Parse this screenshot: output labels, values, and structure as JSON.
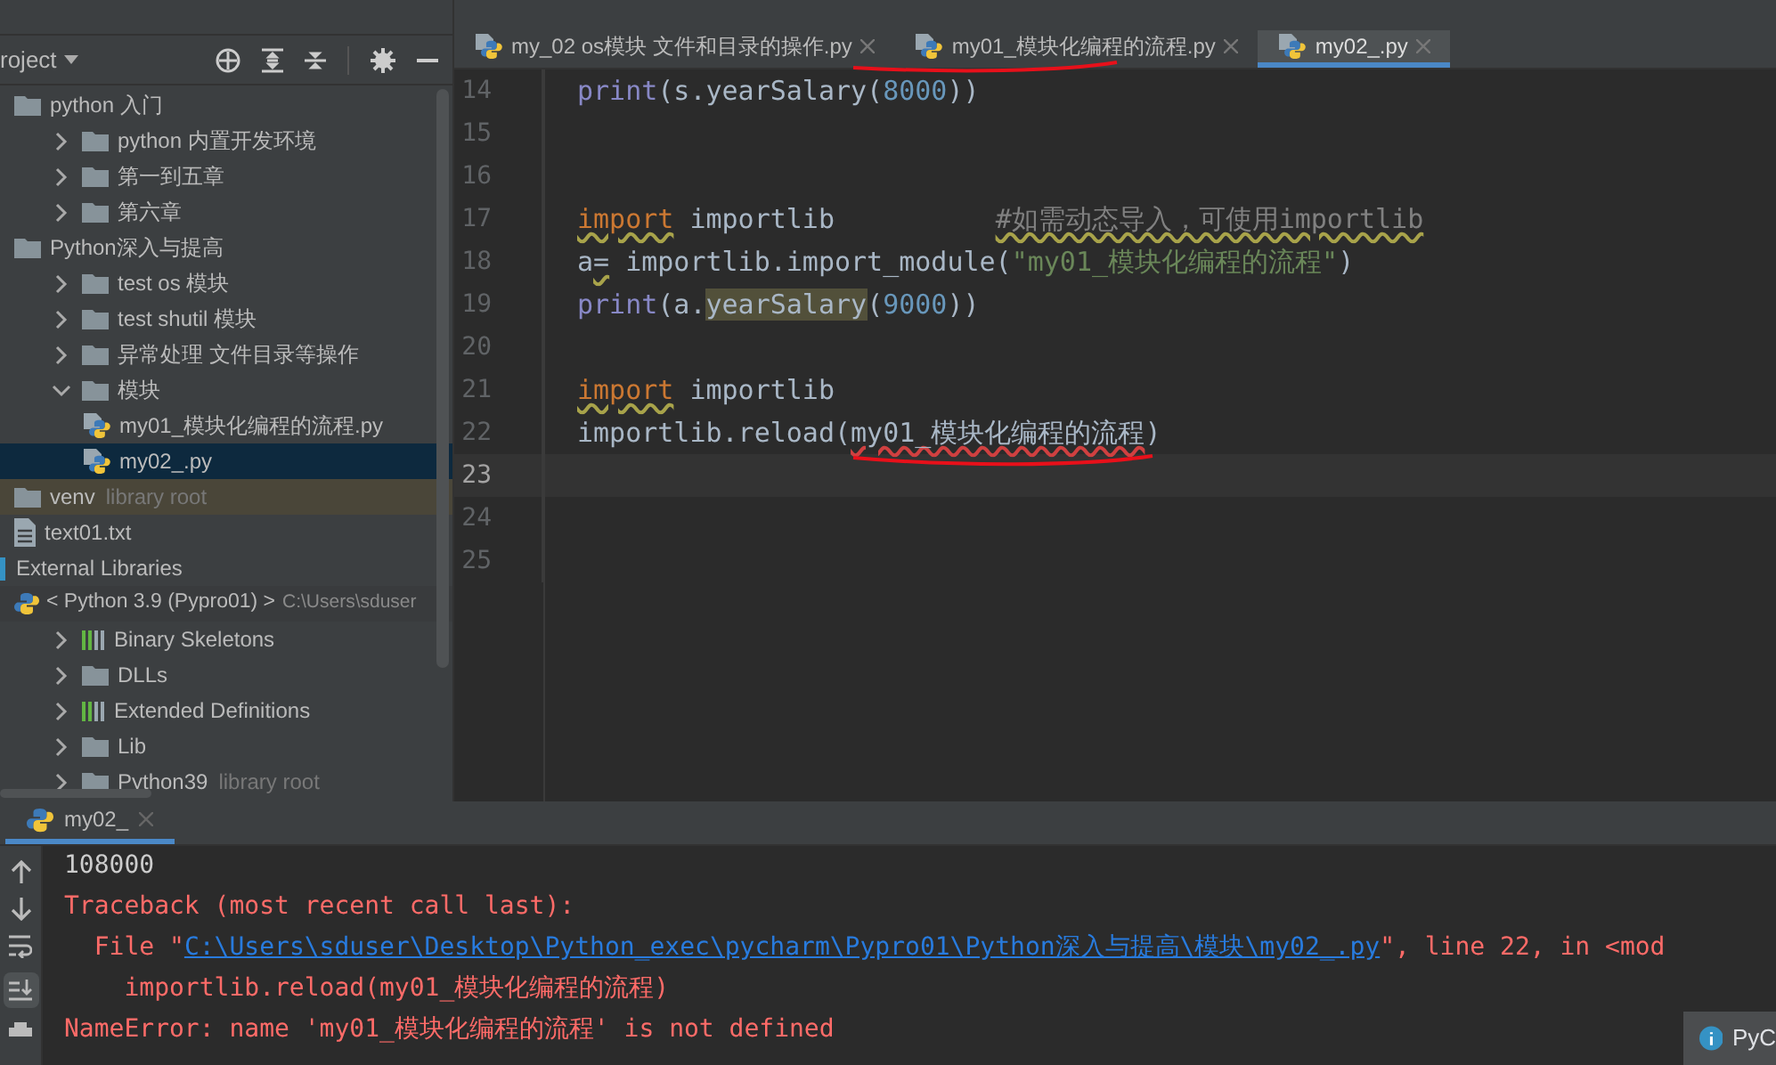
{
  "project_header": {
    "label": "roject"
  },
  "tree": [
    {
      "label": "python 入门",
      "kind": "folder",
      "selected": false,
      "children": [
        {
          "label": "python 内置开发环境",
          "kind": "folder",
          "selected": false,
          "expanded": false
        },
        {
          "label": "第一到五章",
          "kind": "folder",
          "selected": false,
          "expanded": false
        },
        {
          "label": "第六章",
          "kind": "folder",
          "selected": false,
          "expanded": false
        }
      ]
    },
    {
      "label": "Python深入与提高",
      "kind": "folder",
      "selected": false,
      "children": [
        {
          "label": "test os 模块",
          "kind": "folder",
          "selected": false,
          "expanded": false
        },
        {
          "label": "test shutil 模块",
          "kind": "folder",
          "selected": false,
          "expanded": false
        },
        {
          "label": "异常处理 文件目录等操作",
          "kind": "folder",
          "selected": false,
          "expanded": false
        },
        {
          "label": "模块",
          "kind": "folder",
          "selected": false,
          "expanded": true,
          "children": [
            {
              "label": "my01_模块化编程的流程.py",
              "kind": "pyfile",
              "selected": false
            },
            {
              "label": "my02_.py",
              "kind": "pyfile",
              "selected": true
            }
          ]
        }
      ]
    },
    {
      "label": "venv",
      "note": "library root",
      "kind": "folder",
      "selected": false
    },
    {
      "label": "text01.txt",
      "kind": "txt",
      "selected": false
    }
  ],
  "external": {
    "label": "External Libraries",
    "sdk": {
      "label": "< Python 3.9 (Pypro01) >",
      "note": "C:\\Users\\sduser",
      "children": [
        {
          "label": "Binary Skeletons",
          "kind": "lib",
          "selected": false,
          "expanded": false
        },
        {
          "label": "DLLs",
          "kind": "folder",
          "selected": false,
          "expanded": false
        },
        {
          "label": "Extended Definitions",
          "kind": "lib",
          "selected": false,
          "expanded": false
        },
        {
          "label": "Lib",
          "kind": "folder",
          "selected": false,
          "expanded": false
        },
        {
          "label": "Python39",
          "note": "library root",
          "kind": "folder",
          "selected": false,
          "expanded": false
        }
      ]
    }
  },
  "tabs": [
    {
      "label": "my_02 os模块 文件和目录的操作.py",
      "selected": false
    },
    {
      "label": "my01_模块化编程的流程.py",
      "selected": false
    },
    {
      "label": "my02_.py",
      "selected": true
    }
  ],
  "editor": {
    "lines": [
      {
        "number": "14",
        "current": false,
        "tokens": [
          {
            "kind": "fn",
            "text": "print"
          },
          {
            "kind": "plain",
            "text": "(s.yearSalary("
          },
          {
            "kind": "num",
            "text": "8000"
          },
          {
            "kind": "plain",
            "text": "))"
          }
        ]
      },
      {
        "number": "15",
        "current": false
      },
      {
        "number": "16",
        "current": false
      },
      {
        "number": "17",
        "current": false,
        "tokens": [
          {
            "kind": "kw",
            "text": "import",
            "warning": true
          },
          {
            "kind": "plain",
            "text": " importlib          "
          },
          {
            "kind": "comment",
            "text": "#如需动态导入，可使用importlib",
            "warning": true
          }
        ]
      },
      {
        "number": "18",
        "current": false,
        "tokens": [
          {
            "kind": "plain",
            "text": "a"
          },
          {
            "kind": "plain",
            "text": "=",
            "warning": true
          },
          {
            "kind": "plain",
            "text": " importlib.import_module("
          },
          {
            "kind": "str",
            "text": "\"my01_模块化编程的流程\""
          },
          {
            "kind": "plain",
            "text": ")"
          }
        ]
      },
      {
        "number": "19",
        "current": false,
        "tokens": [
          {
            "kind": "fn",
            "text": "print"
          },
          {
            "kind": "plain",
            "text": "(a."
          },
          {
            "kind": "hl",
            "text": "yearSalary"
          },
          {
            "kind": "plain",
            "text": "("
          },
          {
            "kind": "num",
            "text": "9000"
          },
          {
            "kind": "plain",
            "text": "))"
          }
        ]
      },
      {
        "number": "20",
        "current": false
      },
      {
        "number": "21",
        "current": false,
        "tokens": [
          {
            "kind": "kw",
            "text": "import",
            "warning": true
          },
          {
            "kind": "plain",
            "text": " importlib"
          }
        ]
      },
      {
        "number": "22",
        "current": false,
        "tokens": [
          {
            "kind": "plain",
            "text": "importlib.reload("
          },
          {
            "kind": "plain",
            "text": "my01_模块化编程的流程",
            "error": true
          },
          {
            "kind": "plain",
            "text": ")"
          }
        ]
      },
      {
        "number": "23",
        "current": true
      },
      {
        "number": "24",
        "current": false
      },
      {
        "number": "25",
        "current": false
      }
    ]
  },
  "run_panel": {
    "tab": "my02_",
    "lines": [
      {
        "kind": "out",
        "parts": [
          {
            "kind": "text",
            "text": "108000"
          }
        ]
      },
      {
        "kind": "err",
        "parts": [
          {
            "kind": "text",
            "text": "Traceback (most recent call last):"
          }
        ]
      },
      {
        "kind": "err",
        "parts": [
          {
            "kind": "text",
            "text": "  File \""
          },
          {
            "kind": "link",
            "text": "C:\\Users\\sduser\\Desktop\\Python_exec\\pycharm\\Pypro01\\Python深入与提高\\模块\\my02_.py"
          },
          {
            "kind": "text",
            "text": "\", line 22, in <mod"
          }
        ]
      },
      {
        "kind": "err",
        "parts": [
          {
            "kind": "text",
            "text": "    importlib.reload(my01_模块化编程的流程)"
          }
        ]
      },
      {
        "kind": "err",
        "parts": [
          {
            "kind": "text",
            "text": "NameError: name 'my01_模块化编程的流程' is not defined"
          }
        ]
      }
    ]
  },
  "notification": {
    "text": "PyC"
  }
}
